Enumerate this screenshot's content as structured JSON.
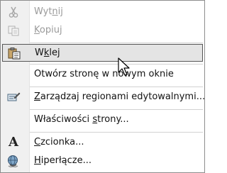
{
  "menu": {
    "items": [
      {
        "pre": "Wyt",
        "u": "n",
        "post": "ij",
        "enabled": false,
        "icon": "scissors-icon"
      },
      {
        "pre": "",
        "u": "K",
        "post": "opiuj",
        "enabled": false,
        "icon": "copy-icon"
      },
      {
        "pre": "W",
        "u": "k",
        "post": "lej",
        "enabled": true,
        "highlighted": true,
        "icon": "paste-clipboard-icon"
      },
      {
        "pre": "",
        "u": "",
        "post": "Otwórz stronę w nowym oknie",
        "enabled": true,
        "icon": ""
      },
      {
        "pre": "",
        "u": "Z",
        "post": "arządzaj regionami edytowalnymi...",
        "enabled": true,
        "icon": "manage-regions-icon"
      },
      {
        "pre": "Właściwości ",
        "u": "s",
        "post": "trony...",
        "enabled": true,
        "icon": ""
      },
      {
        "pre": "",
        "u": "C",
        "post": "zcionka...",
        "enabled": true,
        "icon": "font-icon"
      },
      {
        "pre": "",
        "u": "H",
        "post": "iperłącze...",
        "enabled": true,
        "icon": "hyperlink-globe-icon"
      }
    ],
    "font_icon_glyph": "A"
  },
  "colors": {
    "highlight_bg": "#e4e4e4",
    "highlight_border": "#555555",
    "disabled_text": "#9a9a9a",
    "gutter_bg": "#f0f0f0"
  }
}
